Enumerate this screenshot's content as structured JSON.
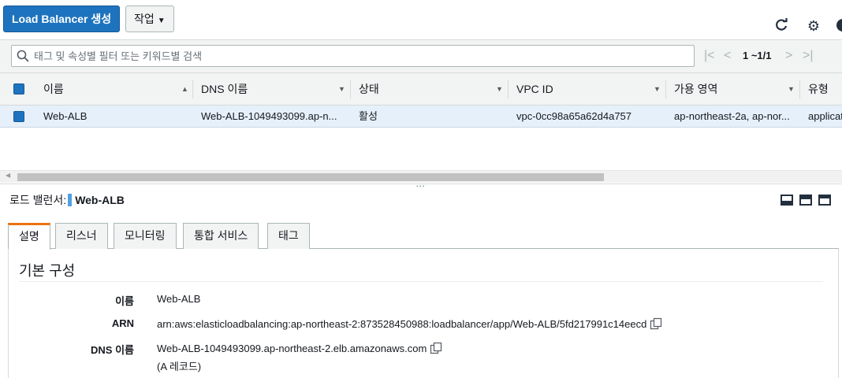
{
  "toolbar": {
    "create_label": "Load Balancer 생성",
    "actions_label": "작업",
    "icons": [
      "refresh-icon",
      "gear-icon",
      "help-icon"
    ]
  },
  "filter": {
    "placeholder": "태그 및 속성별 필터 또는 키워드별 검색",
    "pager_text": "1 ~1/1"
  },
  "table": {
    "columns": [
      "이름",
      "DNS 이름",
      "상태",
      "VPC ID",
      "가용 영역",
      "유형"
    ],
    "rows": [
      {
        "name": "Web-ALB",
        "dns": "Web-ALB-1049493099.ap-n...",
        "state": "활성",
        "vpc": "vpc-0cc98a65a62d4a757",
        "az": "ap-northeast-2a, ap-nor...",
        "type": "applicat"
      }
    ]
  },
  "detail": {
    "label": "로드 밸런서:",
    "name": "Web-ALB",
    "tabs": [
      "설명",
      "리스너",
      "모니터링",
      "통합 서비스",
      "태그"
    ],
    "active_tab": "설명",
    "section_title": "기본 구성",
    "fields": [
      {
        "label": "이름",
        "value": "Web-ALB"
      },
      {
        "label": "ARN",
        "value": "arn:aws:elasticloadbalancing:ap-northeast-2:873528450988:loadbalancer/app/Web-ALB/5fd217991c14eecd"
      },
      {
        "label": "DNS 이름",
        "value": "Web-ALB-1049493099.ap-northeast-2.elb.amazonaws.com",
        "note": "(A 레코드)"
      }
    ]
  },
  "colors": {
    "primary": "#1e73be",
    "tab_accent": "#ec7211",
    "selected_row": "#e6f0fa"
  }
}
